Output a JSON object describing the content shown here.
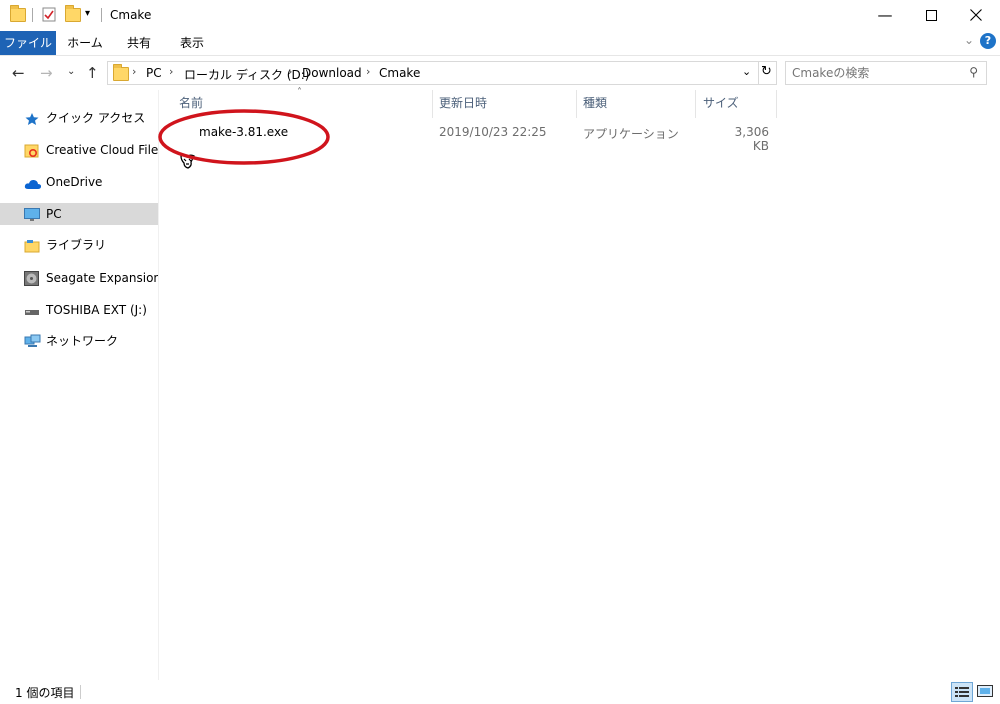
{
  "window": {
    "title": "Cmake"
  },
  "ribbon": {
    "tabs": [
      "ファイル",
      "ホーム",
      "共有",
      "表示"
    ]
  },
  "nav": {
    "breadcrumbs": [
      "PC",
      "ローカル ディスク (D:)",
      "Download",
      "Cmake"
    ],
    "search_placeholder": "Cmakeの検索"
  },
  "sidebar": {
    "items": [
      {
        "label": "クイック アクセス",
        "icon": "star-icon"
      },
      {
        "label": "Creative Cloud Files",
        "icon": "creative-cloud-folder-icon"
      },
      {
        "label": "OneDrive",
        "icon": "onedrive-cloud-icon"
      },
      {
        "label": "PC",
        "icon": "pc-monitor-icon",
        "selected": true
      },
      {
        "label": "ライブラリ",
        "icon": "library-folder-icon"
      },
      {
        "label": "Seagate Expansion Dr",
        "icon": "external-drive-icon"
      },
      {
        "label": "TOSHIBA EXT (J:)",
        "icon": "usb-drive-icon"
      },
      {
        "label": "ネットワーク",
        "icon": "network-icon"
      }
    ]
  },
  "columns": {
    "name": "名前",
    "modified": "更新日時",
    "type": "種類",
    "size": "サイズ"
  },
  "files": [
    {
      "name": "make-3.81.exe",
      "modified": "2019/10/23 22:25",
      "type": "アプリケーション",
      "size": "3,306 KB",
      "icon": "gnu-installer-icon"
    }
  ],
  "status": {
    "count_text": "1 個の項目"
  },
  "colors": {
    "file_tab": "#1e63b5",
    "annotation": "#d0141c",
    "selected_row": "#d9d9d9"
  }
}
